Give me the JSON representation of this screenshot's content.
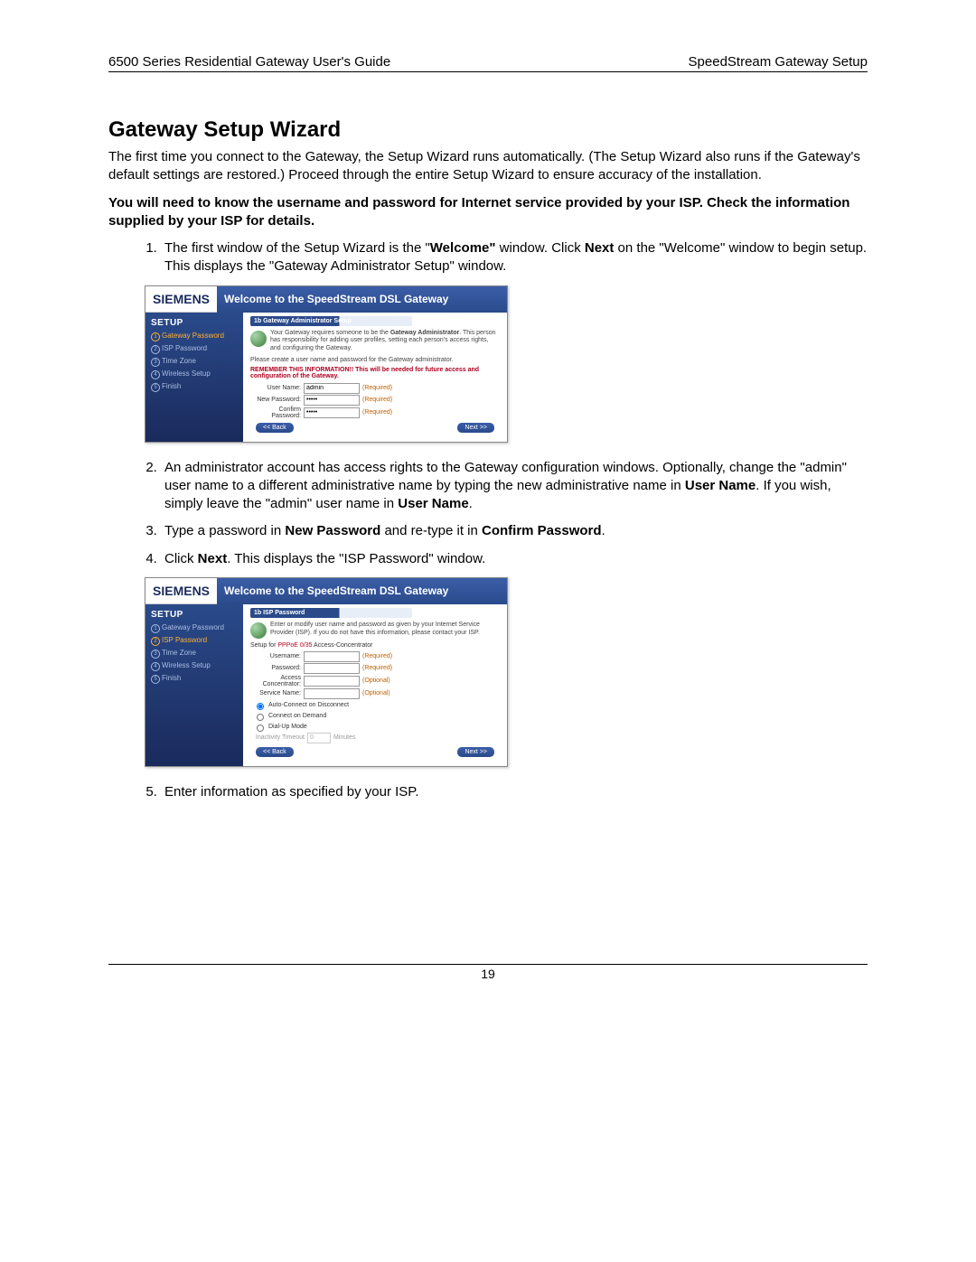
{
  "header": {
    "left": "6500 Series Residential Gateway User's Guide",
    "right": "SpeedStream Gateway Setup"
  },
  "title": "Gateway Setup Wizard",
  "p_intro": "The first time you connect to the Gateway, the Setup Wizard runs automatically. (The Setup Wizard also runs if the Gateway's default settings are restored.) Proceed through the entire Setup Wizard to ensure accuracy of the installation.",
  "p_note": "You will need to know the username and password for Internet service provided by your ISP. Check the information supplied by your ISP for details.",
  "steps": {
    "s1a": "The first window of the Setup Wizard is the \"",
    "s1b": "Welcome\"",
    "s1c": " window. Click ",
    "s1d": "Next",
    "s1e": " on the \"Welcome\" window to begin setup. This displays the \"Gateway Administrator Setup\" window.",
    "s2a": "An administrator account has access rights to the Gateway configuration windows. Optionally, change the \"admin\" user name to a different administrative name by typing the new administrative name in ",
    "s2b": "User Name",
    "s2c": ". If you wish, simply leave the \"admin\" user name in ",
    "s2d": "User Name",
    "s2e": ".",
    "s3a": "Type a password in ",
    "s3b": "New Password",
    "s3c": " and re-type it in ",
    "s3d": "Confirm Password",
    "s3e": ".",
    "s4a": "Click ",
    "s4b": "Next",
    "s4c": ". This displays the \"ISP Password\" window.",
    "s5": "Enter information as specified by your ISP."
  },
  "wizard_common": {
    "brand": "SIEMENS",
    "title": "Welcome to the SpeedStream DSL Gateway",
    "side_header": "SETUP",
    "back": "<< Back",
    "next": "Next >>"
  },
  "wizard1": {
    "side": [
      "Gateway Password",
      "ISP Password",
      "Time Zone",
      "Wireless Setup",
      "Finish"
    ],
    "active_index": 0,
    "crumb": "1b  Gateway Administrator Setup",
    "intro1": "Your Gateway requires someone to be the ",
    "intro1b": "Gateway Administrator",
    "intro1c": ". This person has responsibility for adding user profiles, setting each person's access rights, and configuring the Gateway.",
    "para2": "Please create a user name and password for the Gateway administrator.",
    "warn_label": "REMEMBER THIS INFORMATION!!",
    "warn_rest": " This will be needed for future access and configuration of the Gateway.",
    "rows": [
      {
        "label": "User Name:",
        "value": "admin",
        "hint": "(Required)",
        "type": "text"
      },
      {
        "label": "New Password:",
        "value": "•••••",
        "hint": "(Required)",
        "type": "password"
      },
      {
        "label": "Confirm Password:",
        "value": "•••••",
        "hint": "(Required)",
        "type": "password"
      }
    ]
  },
  "wizard2": {
    "side": [
      "Gateway Password",
      "ISP Password",
      "Time Zone",
      "Wireless Setup",
      "Finish"
    ],
    "active_index": 1,
    "crumb": "1b  ISP Password",
    "intro": "Enter or modify user name and password as given by your Internet Service Provider (ISP). If you do not have this information, please contact your ISP.",
    "setupfor_prefix": "Setup for ",
    "setupfor_link": "PPPoE 0/35",
    "setupfor_suffix": "   Access-Concentrator",
    "rows": [
      {
        "label": "Username:",
        "hint": "(Required)"
      },
      {
        "label": "Password:",
        "hint": "(Required)"
      },
      {
        "label": "Access Concentrator:",
        "hint": "(Optional)"
      },
      {
        "label": "Service Name:",
        "hint": "(Optional)"
      }
    ],
    "radios": [
      "Auto-Connect on Disconnect",
      "Connect on Demand",
      "Dial-Up Mode"
    ],
    "timeout_label": "Inactivity Timeout",
    "timeout_value": "0",
    "timeout_unit": "Minutes"
  },
  "page_number": "19"
}
